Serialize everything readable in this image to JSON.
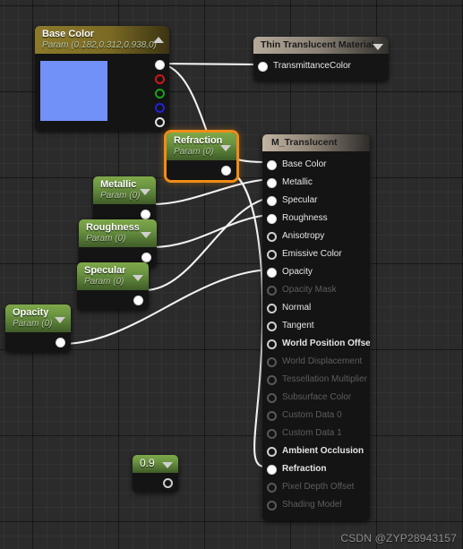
{
  "watermark": "CSDN @ZYP28943157",
  "colors": {
    "canvas": "#2b2b2b",
    "selection": "#f08c16",
    "param_header": "#6a9440",
    "basecolor_swatch": "#7291f8",
    "wire": "#f2f2f2"
  },
  "nodes": {
    "base_color": {
      "title": "Base Color",
      "subtitle": "Param (0.182,0.312,0.938,0)",
      "swatch_color": "#7291f8",
      "collapse_icon": "chevron-up-icon",
      "outputs": [
        {
          "label": "",
          "pin": "filled",
          "name": "rgba"
        },
        {
          "label": "",
          "pin": "red",
          "name": "r"
        },
        {
          "label": "",
          "pin": "green",
          "name": "g"
        },
        {
          "label": "",
          "pin": "blue",
          "name": "b"
        },
        {
          "label": "",
          "pin": "white-h",
          "name": "a"
        }
      ]
    },
    "thin_translucent": {
      "title": "Thin Translucent Material",
      "collapse_icon": "chevron-down-icon",
      "inputs": [
        {
          "label": "TransmittanceColor",
          "pin": "filled",
          "enabled": true
        }
      ]
    },
    "m_translucent": {
      "title": "M_Translucent",
      "inputs": [
        {
          "label": "Base Color",
          "pin": "filled",
          "enabled": true,
          "bold": false
        },
        {
          "label": "Metallic",
          "pin": "filled",
          "enabled": true,
          "bold": false
        },
        {
          "label": "Specular",
          "pin": "filled",
          "enabled": true,
          "bold": false
        },
        {
          "label": "Roughness",
          "pin": "filled",
          "enabled": true,
          "bold": false
        },
        {
          "label": "Anisotropy",
          "pin": "hollow",
          "enabled": true,
          "bold": false
        },
        {
          "label": "Emissive Color",
          "pin": "hollow",
          "enabled": true,
          "bold": false
        },
        {
          "label": "Opacity",
          "pin": "filled",
          "enabled": true,
          "bold": false
        },
        {
          "label": "Opacity Mask",
          "pin": "dim",
          "enabled": false,
          "bold": false
        },
        {
          "label": "Normal",
          "pin": "hollow",
          "enabled": true,
          "bold": false
        },
        {
          "label": "Tangent",
          "pin": "hollow",
          "enabled": true,
          "bold": false
        },
        {
          "label": "World Position Offset",
          "pin": "hollow",
          "enabled": true,
          "bold": true
        },
        {
          "label": "World Displacement",
          "pin": "dim",
          "enabled": false,
          "bold": false
        },
        {
          "label": "Tessellation Multiplier",
          "pin": "dim",
          "enabled": false,
          "bold": false
        },
        {
          "label": "Subsurface Color",
          "pin": "dim",
          "enabled": false,
          "bold": false
        },
        {
          "label": "Custom Data 0",
          "pin": "dim",
          "enabled": false,
          "bold": false
        },
        {
          "label": "Custom Data 1",
          "pin": "dim",
          "enabled": false,
          "bold": false
        },
        {
          "label": "Ambient Occlusion",
          "pin": "hollow",
          "enabled": true,
          "bold": true
        },
        {
          "label": "Refraction",
          "pin": "filled",
          "enabled": true,
          "bold": true
        },
        {
          "label": "Pixel Depth Offset",
          "pin": "dim",
          "enabled": false,
          "bold": false
        },
        {
          "label": "Shading Model",
          "pin": "dim",
          "enabled": false,
          "bold": false
        }
      ]
    },
    "refraction": {
      "title": "Refraction",
      "subtitle": "Param (0)",
      "selected": true,
      "collapse_icon": "chevron-down-icon"
    },
    "metallic": {
      "title": "Metallic",
      "subtitle": "Param (0)",
      "selected": false,
      "collapse_icon": "chevron-down-icon"
    },
    "roughness": {
      "title": "Roughness",
      "subtitle": "Param (0)",
      "selected": false,
      "collapse_icon": "chevron-down-icon"
    },
    "specular": {
      "title": "Specular",
      "subtitle": "Param (0)",
      "selected": false,
      "collapse_icon": "chevron-down-icon"
    },
    "opacity": {
      "title": "Opacity",
      "subtitle": "Param (0)",
      "selected": false,
      "collapse_icon": "chevron-down-icon"
    },
    "constant": {
      "title": "0.9",
      "collapse_icon": "chevron-down-icon"
    }
  },
  "connections": [
    {
      "from": "base_color.rgba",
      "to": "thin_translucent.TransmittanceColor"
    },
    {
      "from": "base_color.rgba",
      "to": "m_translucent.Base Color"
    },
    {
      "from": "metallic.out",
      "to": "m_translucent.Metallic"
    },
    {
      "from": "roughness.out",
      "to": "m_translucent.Roughness"
    },
    {
      "from": "specular.out",
      "to": "m_translucent.Specular"
    },
    {
      "from": "opacity.out",
      "to": "m_translucent.Opacity"
    },
    {
      "from": "refraction.out",
      "to": "m_translucent.Refraction"
    }
  ]
}
